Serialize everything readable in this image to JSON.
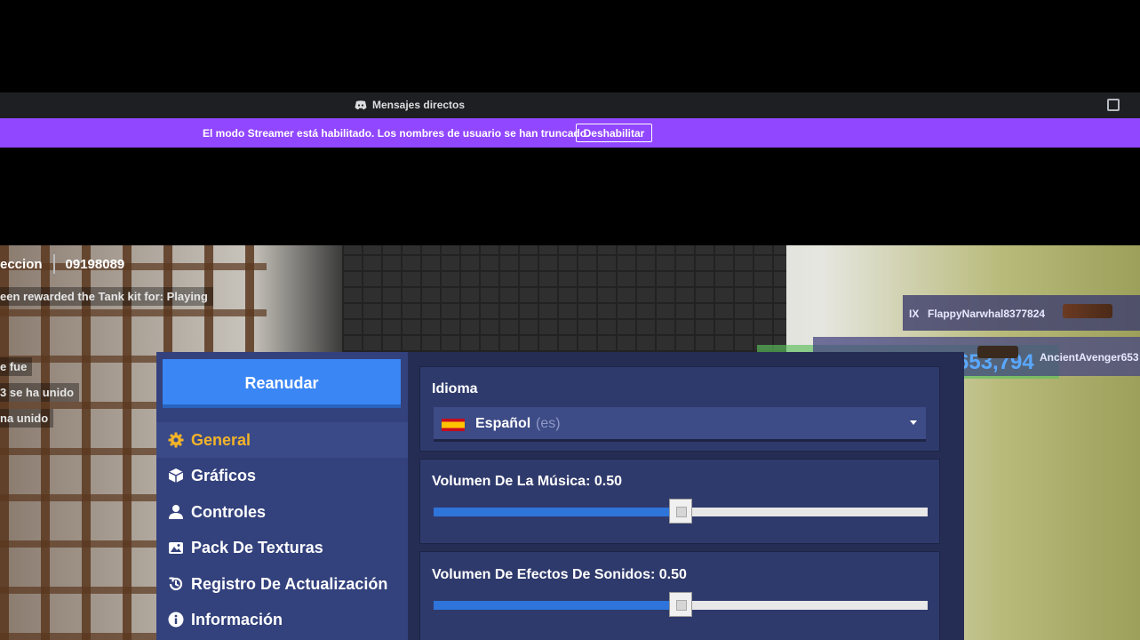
{
  "discord": {
    "dm_label": "Mensajes directos",
    "streamer_notice": "El modo Streamer está habilitado. Los nombres de usuario se han truncado.",
    "disable_label": "Deshabilitar",
    "accent": "#9146ff"
  },
  "hud": {
    "top_left": "eccion",
    "score": "09198089",
    "feed": [
      "een rewarded the Tank kit for: Playing",
      "e fue",
      "3  se ha unido",
      "na unido"
    ],
    "killfeed": {
      "tag": "IX",
      "player1": "FlappyNarwhal8377824",
      "big_score": "653,794",
      "player2": "AncientAvenger653"
    }
  },
  "menu": {
    "resume_label": "Reanudar",
    "items": [
      {
        "label": "General",
        "icon": "gear-icon",
        "active": true
      },
      {
        "label": "Gráficos",
        "icon": "cube-icon",
        "active": false
      },
      {
        "label": "Controles",
        "icon": "person-icon",
        "active": false
      },
      {
        "label": "Pack De Texturas",
        "icon": "image-icon",
        "active": false
      },
      {
        "label": "Registro De Actualización",
        "icon": "history-icon",
        "active": false
      },
      {
        "label": "Información",
        "icon": "info-icon",
        "active": false
      }
    ]
  },
  "settings": {
    "language": {
      "title": "Idioma",
      "value": "Español",
      "code": "(es)"
    },
    "music": {
      "title": "Volumen De La Música: 0.50",
      "value": 0.5
    },
    "sfx": {
      "title": "Volumen De Efectos De Sonidos: 0.50",
      "value": 0.5
    }
  }
}
